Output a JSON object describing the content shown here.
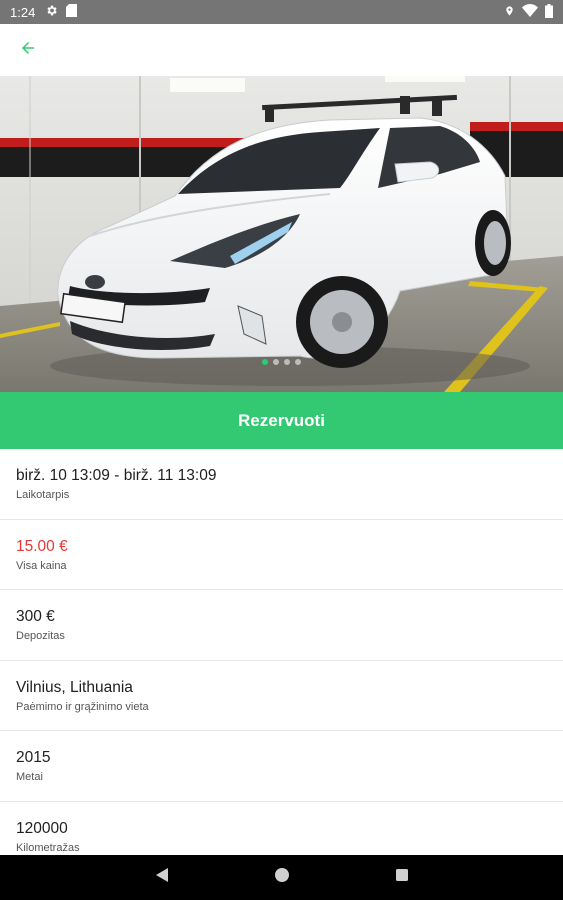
{
  "status_bar": {
    "time": "1:24",
    "icons": [
      "gear-icon",
      "sim-card-icon",
      "location-icon",
      "wifi-icon",
      "battery-icon"
    ]
  },
  "app_bar": {
    "back_icon": "arrow-left-icon",
    "accent_color": "#2ecc71"
  },
  "gallery": {
    "image": "white-toyota-prius-photo",
    "page_count": 4,
    "active_index": 0
  },
  "reserve_button": {
    "label": "Rezervuoti",
    "color": "#33c972"
  },
  "details": [
    {
      "value": "birž. 10 13:09 - birž. 11 13:09",
      "label": "Laikotarpis"
    },
    {
      "value": "15.00 €",
      "label": "Visa kaina",
      "value_color": "#e53935"
    },
    {
      "value": "300 €",
      "label": "Depozitas"
    },
    {
      "value": "Vilnius, Lithuania",
      "label": "Paėmimo ir grąžinimo vieta"
    },
    {
      "value": "2015",
      "label": "Metai"
    },
    {
      "value": "120000",
      "label": "Kilometražas"
    }
  ],
  "nav_bar": {
    "icons": [
      "back-triangle-icon",
      "home-circle-icon",
      "recents-square-icon"
    ]
  }
}
